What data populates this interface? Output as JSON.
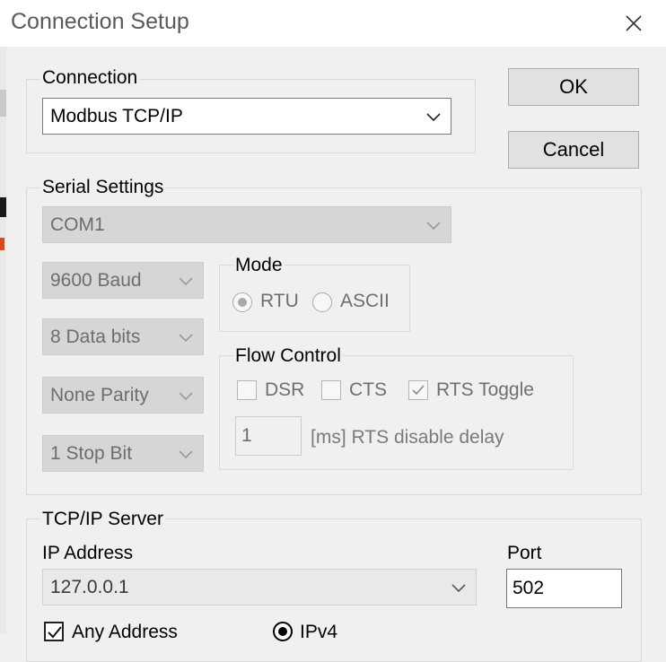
{
  "window": {
    "title": "Connection Setup"
  },
  "buttons": {
    "ok": "OK",
    "cancel": "Cancel"
  },
  "connection": {
    "group_label": "Connection",
    "selected": "Modbus TCP/IP"
  },
  "serial": {
    "group_label": "Serial Settings",
    "port": "COM1",
    "baud": "9600 Baud",
    "data_bits": "8 Data bits",
    "parity": "None Parity",
    "stop_bits": "1 Stop Bit"
  },
  "mode": {
    "group_label": "Mode",
    "rtu": "RTU",
    "ascii": "ASCII",
    "selected": "RTU"
  },
  "flow_control": {
    "group_label": "Flow Control",
    "dsr": "DSR",
    "cts": "CTS",
    "rts_toggle": "RTS Toggle",
    "rts_toggle_checked": true,
    "delay_value": "1",
    "delay_label": "[ms] RTS disable delay"
  },
  "tcp": {
    "group_label": "TCP/IP Server",
    "ip_label": "IP Address",
    "ip_value": "127.0.0.1",
    "port_label": "Port",
    "port_value": "502",
    "any_address": "Any Address",
    "any_address_checked": true,
    "ipv4": "IPv4",
    "ipv4_selected": true
  },
  "icons": {
    "close": "close-icon",
    "dropdown": "chevron-down-icon",
    "check": "checkmark-icon"
  },
  "colors": {
    "window_bg": "#f0f0f0",
    "titlebar_bg": "#ffffff",
    "disabled_bg": "#d6d6d6",
    "group_border": "#d9d9d9"
  }
}
